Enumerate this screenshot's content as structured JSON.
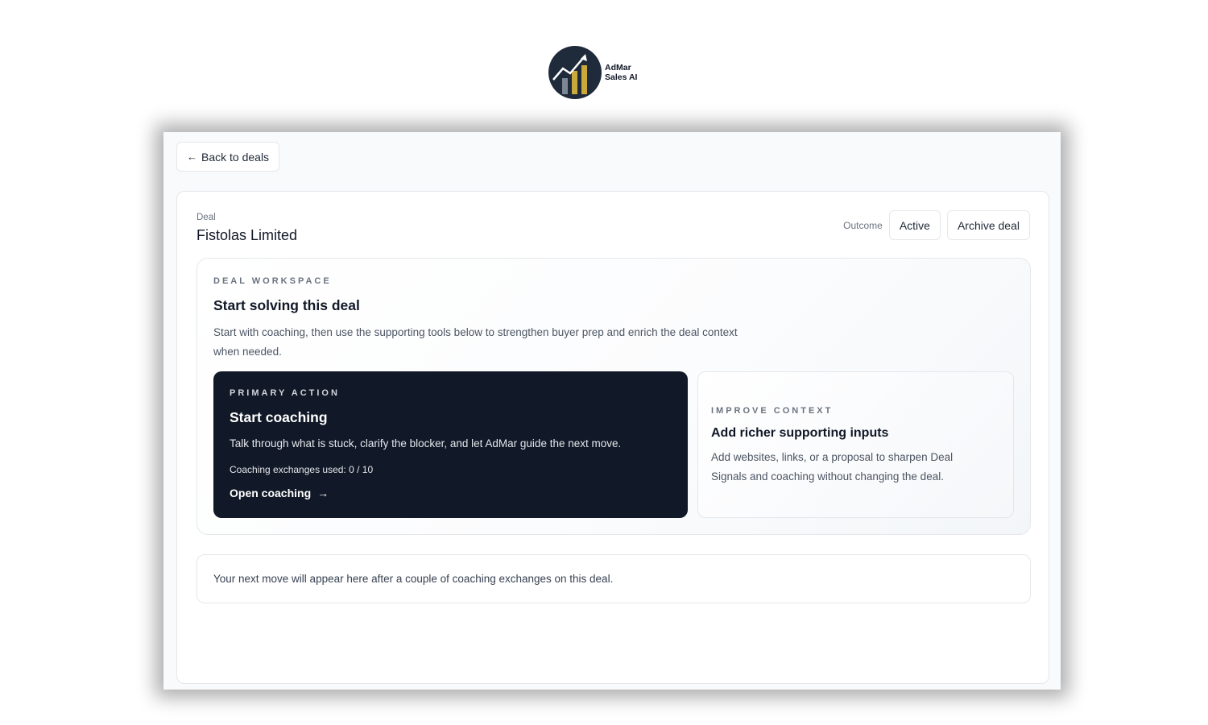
{
  "brand": {
    "line1": "AdMar",
    "line2": "Sales AI",
    "colors": {
      "circle": "#1f2a3a",
      "bars": "#c9a93a"
    }
  },
  "nav": {
    "back_label": "Back to deals",
    "back_icon": "arrow-left-icon"
  },
  "deal": {
    "label": "Deal",
    "name": "Fistolas Limited",
    "outcome_label": "Outcome",
    "outcome_value": "Active",
    "archive_label": "Archive deal"
  },
  "workspace": {
    "eyebrow": "DEAL WORKSPACE",
    "title": "Start solving this deal",
    "description": "Start with coaching, then use the supporting tools below to strengthen buyer prep and enrich the deal context when needed."
  },
  "primary_action": {
    "eyebrow": "PRIMARY ACTION",
    "title": "Start coaching",
    "description": "Talk through what is stuck, clarify the blocker, and let AdMar guide the next move.",
    "usage": "Coaching exchanges used: 0 / 10",
    "link_label": "Open coaching",
    "link_icon": "arrow-right-icon",
    "bg_color": "#111827"
  },
  "improve_context": {
    "eyebrow": "IMPROVE CONTEXT",
    "title": "Add richer supporting inputs",
    "description": "Add websites, links, or a proposal to sharpen Deal Signals and coaching without changing the deal."
  },
  "next_move": {
    "text": "Your next move will appear here after a couple of coaching exchanges on this deal."
  }
}
